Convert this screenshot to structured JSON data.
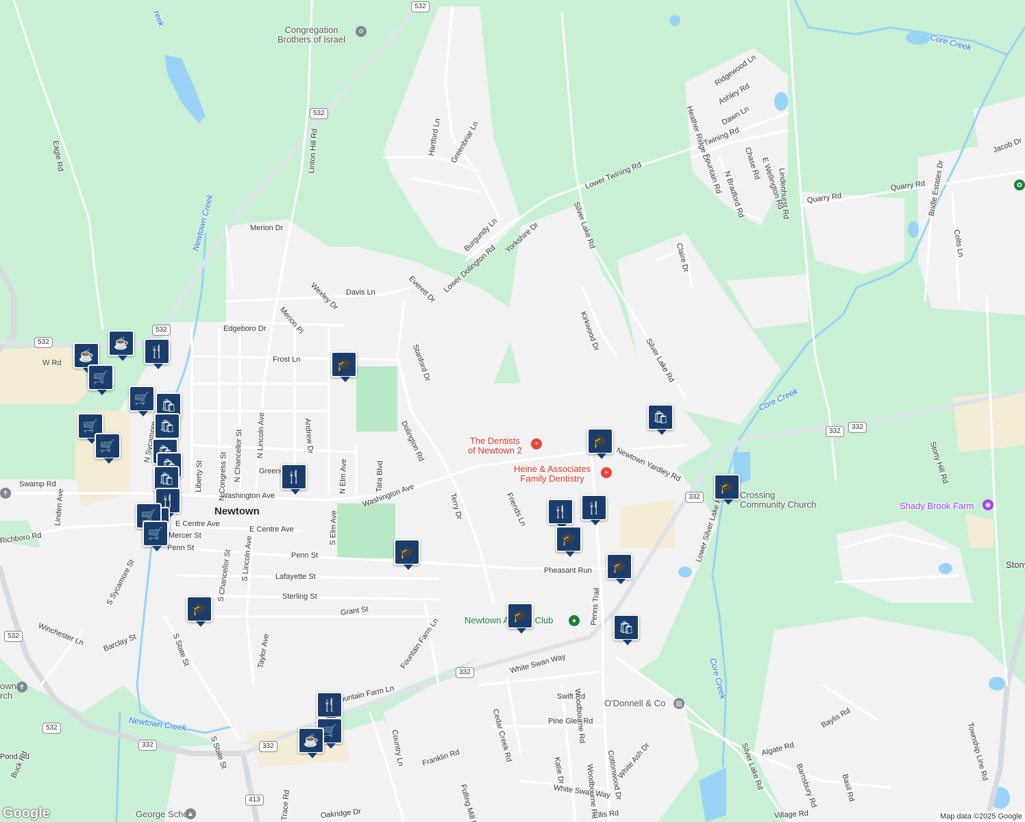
{
  "map": {
    "town": "Newtown",
    "attribution": "Map data ©2025 Google",
    "logo": "Google",
    "colors": {
      "land": "#c9f0d5",
      "urban": "#f2f2f2",
      "road": "#ffffff",
      "highway": "#d6dbe0",
      "park": "#b7e9c7",
      "commercial": "#f5ecd7",
      "water": "#9ad3f5",
      "pin": "#1a3d6b"
    }
  },
  "roads": [
    "Eagle Rd",
    "Merion Dr",
    "Linton Hill Rd",
    "Davis Ln",
    "Wexley Dr",
    "Merion Pl",
    "Everett Dr",
    "Lower Dolington Rd",
    "Yorkshire Dr",
    "Burgundy Ln",
    "Hartford Ln",
    "Greenbriar Ln",
    "Lower Twining Rd",
    "Silver Lake Rd",
    "Claire Dr",
    "Kirkwood Dr",
    "Twining Rd",
    "Ridgewood Ln",
    "Ashley Rd",
    "Dawn Ln",
    "Heather Ridge Dr",
    "Fountain Rd",
    "N Bradford Rd",
    "Chase Rd",
    "E Wellington Rd",
    "Lindenhurst Rd",
    "Quarry Rd",
    "Jacob Dr",
    "Bridle Estates Dr",
    "Colts Ln",
    "Stony Hill Rd",
    "Edgeboro Dr",
    "Frost Ln",
    "W Rd",
    "Stanford Dr",
    "Dolington Rd",
    "Andrew Dr",
    "N Elm Ave",
    "Tara Blvd",
    "Greene",
    "Swamp Rd",
    "Washington Ave",
    "Terry Dr",
    "Friends Ln",
    "Newtown Yardley Rd",
    "Lower Silver Lake Rd",
    "Liberty St",
    "N Congress St",
    "N Chancellor St",
    "N Lincoln Ave",
    "N Sycamore",
    "E Centre Ave",
    "Mercer St",
    "Penn St",
    "Linden Ave",
    "Richboro Rd",
    "S Elm Ave",
    "Lafayette St",
    "Sterling St",
    "Pheasant Run",
    "Penns Trail",
    "Grant St",
    "S Chancellor St",
    "S Lincoln Ave",
    "S Sycamore St",
    "Winchester Ln",
    "Barclay St",
    "S State St",
    "Taylor Ave",
    "Fountain Farm Ln",
    "White Swan Way",
    "Cedar Creek Rd",
    "Swift Rd",
    "Pine Glen Rd",
    "Katie Dr",
    "Cottonwood Dr",
    "White Ash Dr",
    "Woodbourne Rd",
    "Country Ln",
    "Franklin Rd",
    "Fulling Mill Rd",
    "Algate Rd",
    "Barnsbury Rd",
    "Baylis Rd",
    "Basil Rd",
    "Township Line Rd",
    "Pond Rd",
    "Buck Rd",
    "Trace Rd",
    "Oakridge Dr",
    "Ellis Rd",
    "Village Rd",
    "Silver Lake Rd",
    "Trail"
  ],
  "shields": [
    "532",
    "532",
    "532",
    "532",
    "532",
    "332",
    "332",
    "332",
    "332",
    "413",
    "332"
  ],
  "water_labels": [
    "Newtown Creek",
    "Newtown Creek",
    "Core Creek",
    "Core Creek",
    "Core Creek",
    "reek"
  ],
  "places": {
    "congregation": "Congregation\nBrothers of Israel",
    "dentists": "The Dentists\nof Newtown 2",
    "heine": "Heine & Associates\nFamily Dentistry",
    "crossing": "Crossing\nCommunity Church",
    "shady": "Shady Brook Farm",
    "odonnell": "O'Donnell & Co",
    "athletic": "Newtown Athletic Club",
    "george": "George School",
    "newtown_church": "own\nrch",
    "stony": "Stony"
  }
}
